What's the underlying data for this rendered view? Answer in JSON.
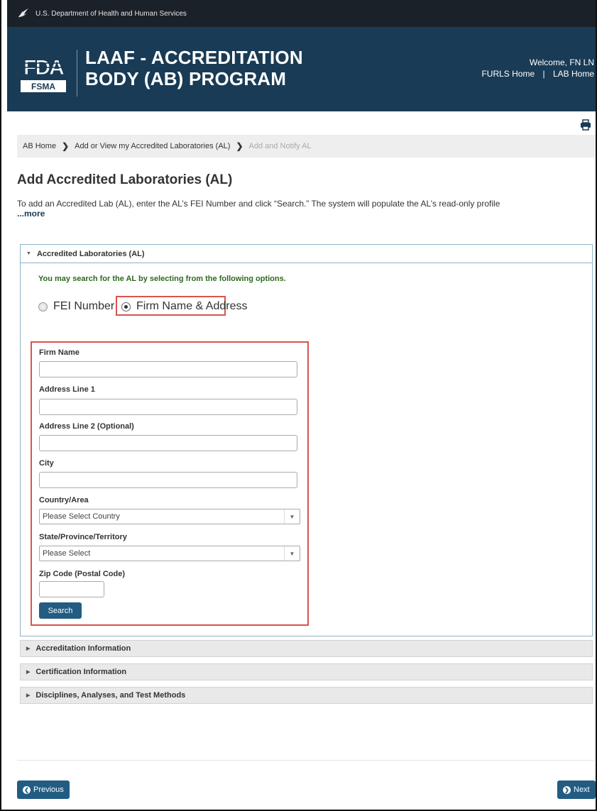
{
  "hhs": {
    "label": "U.S. Department of Health and Human Services"
  },
  "header": {
    "logo_top": "FDA",
    "logo_bottom": "FSMA",
    "title_line1": "LAAF - ACCREDITATION",
    "title_line2": "BODY (AB) PROGRAM",
    "welcome": "Welcome, FN LN",
    "link_furls": "FURLS Home",
    "link_sep": "|",
    "link_lab": "LAB Home"
  },
  "breadcrumb": {
    "item1": "AB Home",
    "item2": "Add or View my Accredited Laboratories (AL)",
    "item3": "Add and Notify AL"
  },
  "page": {
    "title": "Add Accredited Laboratories (AL)",
    "intro": "To add an Accredited Lab (AL), enter the AL’s FEI Number and click “Search.” The system will populate the AL’s read-only profile",
    "more": "...more"
  },
  "panel": {
    "title": "Accredited Laboratories (AL)",
    "note": "You may search for the AL by selecting from the following options.",
    "radio_fei": "FEI Number",
    "radio_firm": "Firm Name & Address",
    "selected": "Firm Name & Address"
  },
  "form": {
    "firm_name_label": "Firm Name",
    "firm_name_value": "",
    "address1_label": "Address Line 1",
    "address1_value": "",
    "address2_label": "Address Line 2 (Optional)",
    "address2_value": "",
    "city_label": "City",
    "city_value": "",
    "country_label": "Country/Area",
    "country_value": "Please Select Country",
    "state_label": "State/Province/Territory",
    "state_value": "Please Select",
    "zip_label": "Zip Code (Postal Code)",
    "zip_value": "",
    "search_label": "Search"
  },
  "sections": {
    "accreditation": "Accreditation Information",
    "certification": "Certification Information",
    "disciplines": "Disciplines, Analyses, and Test Methods"
  },
  "nav": {
    "previous": "Previous",
    "next": "Next"
  },
  "colors": {
    "banner": "#193b55",
    "button": "#225c82",
    "highlight": "#d9534f",
    "note_green": "#2d6a1e"
  }
}
